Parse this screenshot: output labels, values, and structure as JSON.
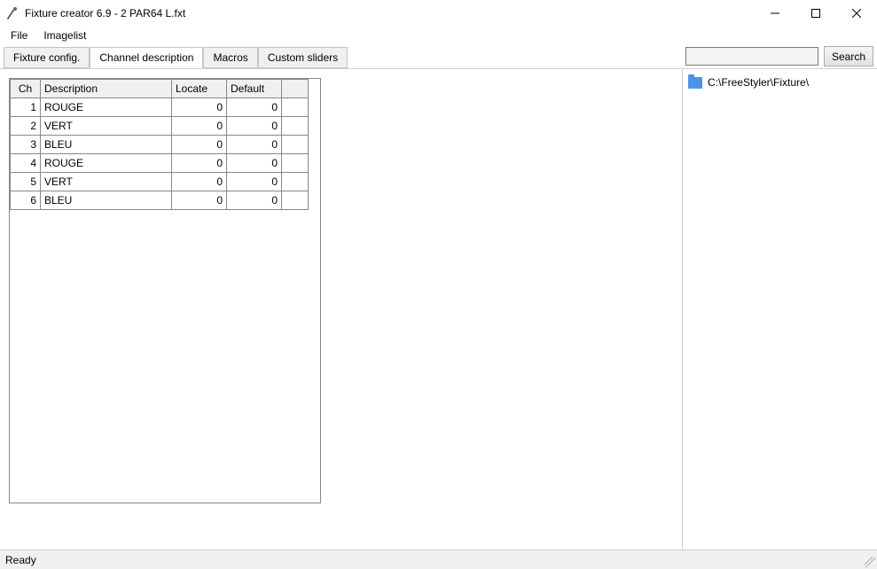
{
  "window": {
    "title": "Fixture creator 6.9 - 2 PAR64 L.fxt"
  },
  "menu": {
    "file": "File",
    "imagelist": "Imagelist"
  },
  "tabs": {
    "fixture_config": "Fixture config.",
    "channel_description": "Channel description",
    "macros": "Macros",
    "custom_sliders": "Custom sliders",
    "active_index": 1
  },
  "search": {
    "value": "",
    "button": "Search"
  },
  "tree": {
    "path": "C:\\FreeStyler\\Fixture\\"
  },
  "table": {
    "headers": {
      "ch": "Ch",
      "description": "Description",
      "locate": "Locate",
      "default": "Default"
    },
    "rows": [
      {
        "ch": "1",
        "description": "ROUGE",
        "locate": "0",
        "default": "0"
      },
      {
        "ch": "2",
        "description": "VERT",
        "locate": "0",
        "default": "0"
      },
      {
        "ch": "3",
        "description": "BLEU",
        "locate": "0",
        "default": "0"
      },
      {
        "ch": "4",
        "description": "ROUGE",
        "locate": "0",
        "default": "0"
      },
      {
        "ch": "5",
        "description": "VERT",
        "locate": "0",
        "default": "0"
      },
      {
        "ch": "6",
        "description": "BLEU",
        "locate": "0",
        "default": "0"
      }
    ]
  },
  "status": {
    "text": "Ready"
  }
}
